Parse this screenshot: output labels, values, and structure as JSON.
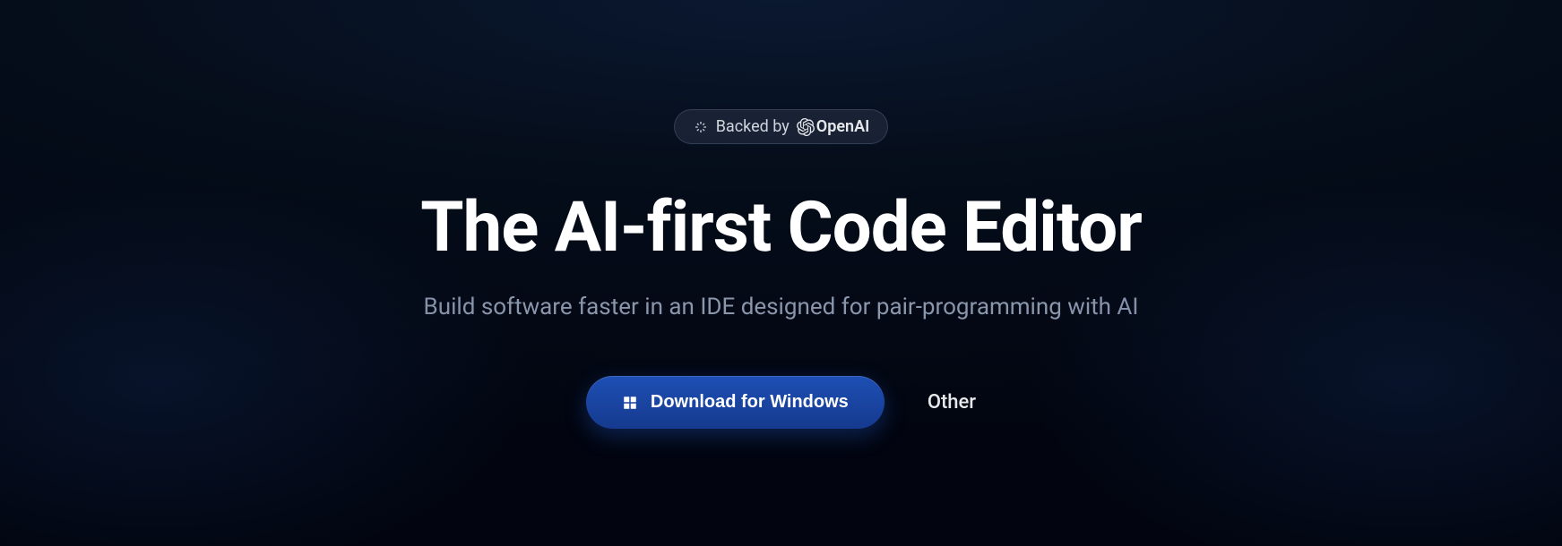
{
  "badge": {
    "prefix": "Backed by",
    "brand": "OpenAI"
  },
  "headline": "The AI-first Code Editor",
  "subhead": "Build software faster in an IDE designed for pair-programming with AI",
  "cta": {
    "download_label": "Download for Windows",
    "other_label": "Other"
  }
}
